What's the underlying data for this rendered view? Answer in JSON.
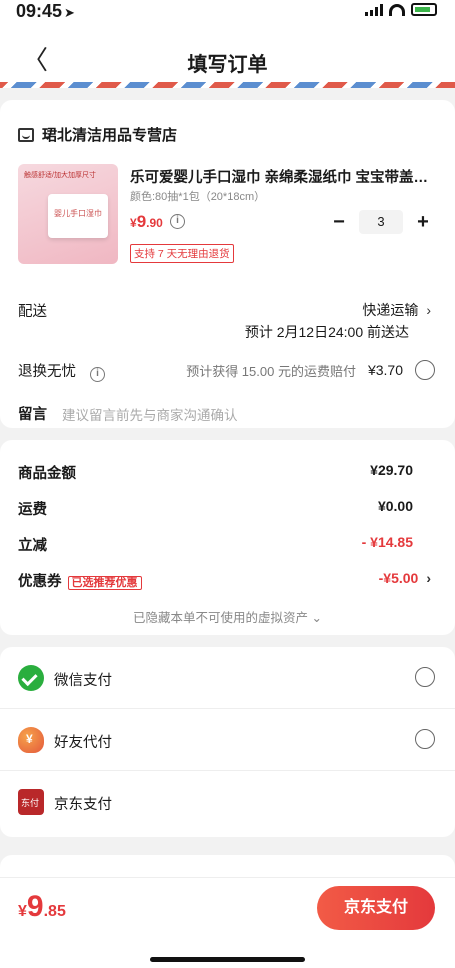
{
  "status": {
    "time": "09:45"
  },
  "nav": {
    "title": "填写订单"
  },
  "shop": {
    "name": "珺北清洁用品专营店"
  },
  "product": {
    "title": "乐可爱婴儿手口湿巾 亲绵柔湿纸巾 宝宝带盖…",
    "spec": "颜色:80抽*1包（20*18cm）",
    "price_currency": "¥",
    "price_int": "9",
    "price_dec": ".90",
    "return_badge": "支持 7 天无理由退货",
    "quantity": "3",
    "image_tags": [
      "触感舒适/加大加厚尺寸"
    ]
  },
  "delivery": {
    "label": "配送",
    "method": "快递运输",
    "eta": "预计 2月12日24:00 前送达"
  },
  "worry_free": {
    "label": "退换无忧",
    "note": "预计获得 15.00 元的运费赔付",
    "price": "¥3.70"
  },
  "remark": {
    "label": "留言",
    "placeholder": "建议留言前先与商家沟通确认"
  },
  "price_summary": {
    "goods_label": "商品金额",
    "goods_value": "¥29.70",
    "shipping_label": "运费",
    "shipping_value": "¥0.00",
    "discount_label": "立减",
    "discount_value": "- ¥14.85",
    "coupon_label": "优惠券",
    "coupon_badge": "已选推荐优惠",
    "coupon_value": "-¥5.00",
    "hidden_note": "已隐藏本单不可使用的虚拟资产 ⌄"
  },
  "payment": {
    "options": [
      {
        "label": "微信支付",
        "icon": "wechat-pay-icon",
        "selected": false
      },
      {
        "label": "好友代付",
        "icon": "friend-pay-icon",
        "selected": false
      },
      {
        "label": "京东支付",
        "icon": "jd-pay-icon",
        "selected": true
      }
    ]
  },
  "footer": {
    "total_currency": "¥",
    "total_int": "9",
    "total_dec": ".85",
    "submit_label": "京东支付"
  },
  "colors": {
    "accent": "#e4393c",
    "wechat": "#2aae3e"
  }
}
